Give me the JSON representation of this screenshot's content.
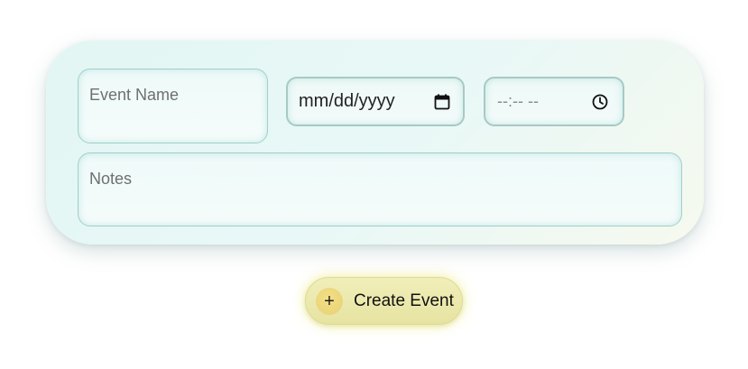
{
  "form": {
    "event_name_placeholder": "Event Name",
    "date_placeholder": "mm/dd/yyyy",
    "time_placeholder": "--:-- --",
    "notes_placeholder": "Notes"
  },
  "actions": {
    "create_icon": "plus-icon",
    "create_icon_glyph": "+",
    "create_label": "Create Event"
  },
  "colors": {
    "card_bg": "#e6f7f5",
    "field_border": "#9fcfcb",
    "button_bg": "#ece9ad",
    "button_icon_bg": "#ebd57a"
  }
}
